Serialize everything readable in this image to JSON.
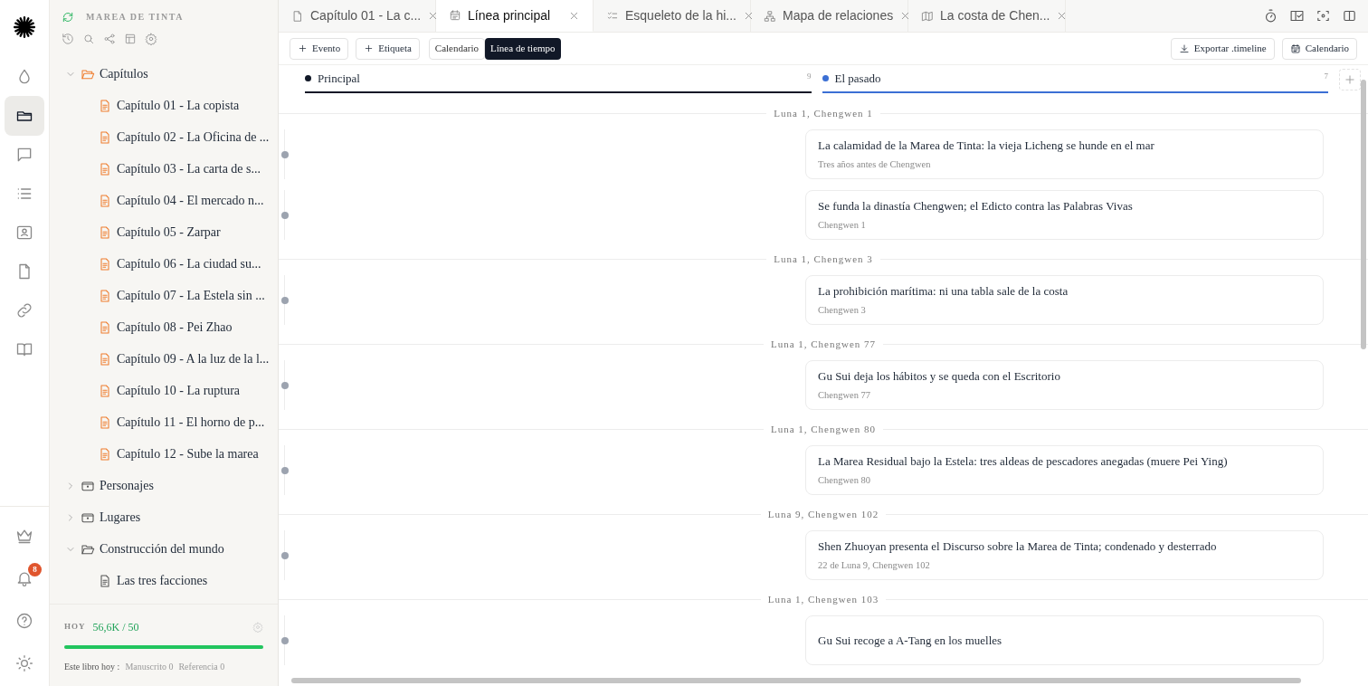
{
  "rail": {
    "top": [
      {
        "selected": false
      },
      {
        "selected": true
      },
      {
        "selected": false
      },
      {
        "selected": false
      },
      {
        "selected": false
      },
      {
        "selected": false
      },
      {
        "selected": false
      },
      {
        "selected": false
      }
    ],
    "notification_badge": "8"
  },
  "sidebar": {
    "title": "MAREA DE TINTA",
    "tree": [
      {
        "label": "Capítulos",
        "kind": "folder",
        "expanded": true,
        "children": [
          {
            "label": "Capítulo 01 - La copista",
            "kind": "chapter"
          },
          {
            "label": "Capítulo 02 - La Oficina de ...",
            "kind": "chapter"
          },
          {
            "label": "Capítulo 03 - La carta de s...",
            "kind": "chapter"
          },
          {
            "label": "Capítulo 04 - El mercado n...",
            "kind": "chapter"
          },
          {
            "label": "Capítulo 05 - Zarpar",
            "kind": "chapter"
          },
          {
            "label": "Capítulo 06 - La ciudad su...",
            "kind": "chapter"
          },
          {
            "label": "Capítulo 07 - La Estela sin ...",
            "kind": "chapter"
          },
          {
            "label": "Capítulo 08 - Pei Zhao",
            "kind": "chapter"
          },
          {
            "label": "Capítulo 09 - A la luz de la l...",
            "kind": "chapter"
          },
          {
            "label": "Capítulo 10 - La ruptura",
            "kind": "chapter"
          },
          {
            "label": "Capítulo 11 - El horno de p...",
            "kind": "chapter"
          },
          {
            "label": "Capítulo 12 - Sube la marea",
            "kind": "chapter"
          }
        ]
      },
      {
        "label": "Personajes",
        "kind": "folder",
        "expanded": false
      },
      {
        "label": "Lugares",
        "kind": "folder",
        "expanded": false
      },
      {
        "label": "Construcción del mundo",
        "kind": "folder",
        "expanded": true,
        "children": [
          {
            "label": "Las tres facciones",
            "kind": "note"
          }
        ]
      }
    ],
    "footer": {
      "label": "HOY",
      "count": "56,6K / 50",
      "level": 1,
      "book_label": "Este libro hoy :",
      "manuscript": "Manuscrito 0",
      "reference": "Referencia 0"
    }
  },
  "tabs": [
    {
      "label": "Capítulo 01 - La c...",
      "selected": false
    },
    {
      "label": "Línea principal",
      "selected": true
    },
    {
      "label": "Esqueleto de la hi...",
      "selected": false
    },
    {
      "label": "Mapa de relaciones",
      "selected": false
    },
    {
      "label": "La costa de Chen...",
      "selected": false
    }
  ],
  "toolbar": {
    "add_buttons": [
      "Evento",
      "Etiqueta"
    ],
    "views": [
      {
        "label": "Calendario",
        "selected": false
      },
      {
        "label": "Línea de tiempo",
        "selected": true
      }
    ],
    "export": "Exportar .timeline",
    "calendar": "Calendario"
  },
  "lanes": [
    {
      "name": "Principal",
      "count": "9",
      "color": "#111827"
    },
    {
      "name": "El pasado",
      "count": "7",
      "color": "#3b6fd4"
    }
  ],
  "groups": [
    {
      "date": "Luna 1, Chengwen 1",
      "events": [
        {
          "title": "La calamidad de la Marea de Tinta: la vieja Licheng se hunde en el mar",
          "subtitle": "Tres años antes de Chengwen"
        },
        {
          "title": "Se funda la dinastía Chengwen; el Edicto contra las Palabras Vivas",
          "subtitle": "Chengwen 1"
        }
      ]
    },
    {
      "date": "Luna 1, Chengwen 3",
      "events": [
        {
          "title": "La prohibición marítima: ni una tabla sale de la costa",
          "subtitle": "Chengwen 3"
        }
      ]
    },
    {
      "date": "Luna 1, Chengwen 77",
      "events": [
        {
          "title": "Gu Sui deja los hábitos y se queda con el Escritorio",
          "subtitle": "Chengwen 77"
        }
      ]
    },
    {
      "date": "Luna 1, Chengwen 80",
      "events": [
        {
          "title": "La Marea Residual bajo la Estela: tres aldeas de pescadores anegadas (muere Pei Ying)",
          "subtitle": "Chengwen 80"
        }
      ]
    },
    {
      "date": "Luna 9, Chengwen 102",
      "events": [
        {
          "title": "Shen Zhuoyan presenta el Discurso sobre la Marea de Tinta; condenado y desterrado",
          "subtitle": "22 de Luna 9, Chengwen 102"
        }
      ]
    },
    {
      "date": "Luna 1, Chengwen 103",
      "events": [
        {
          "title": "Gu Sui recoge a A-Tang en los muelles"
        }
      ]
    }
  ]
}
